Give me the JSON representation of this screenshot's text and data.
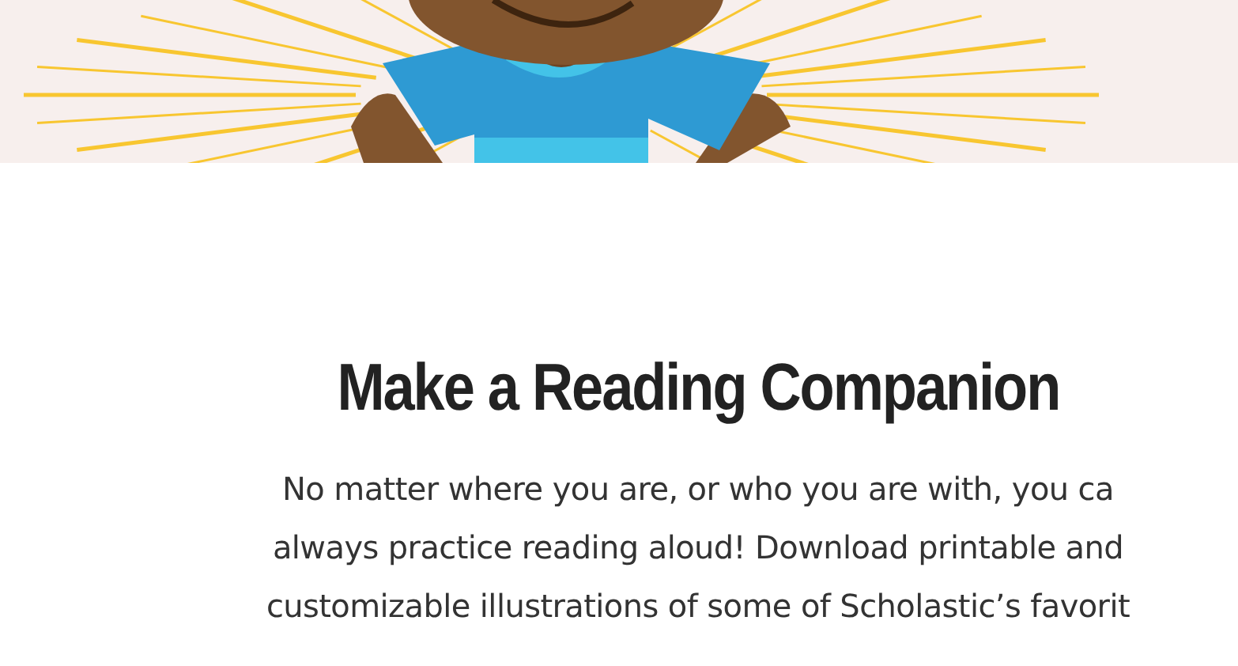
{
  "hero": {
    "kind": "illustration"
  },
  "heading": "Make a Reading Companion",
  "intro_lines": [
    "No matter where you are, or who you are with, you ca",
    "always practice reading aloud! Download printable and",
    "customizable illustrations of some of Scholastic’s favorit"
  ]
}
